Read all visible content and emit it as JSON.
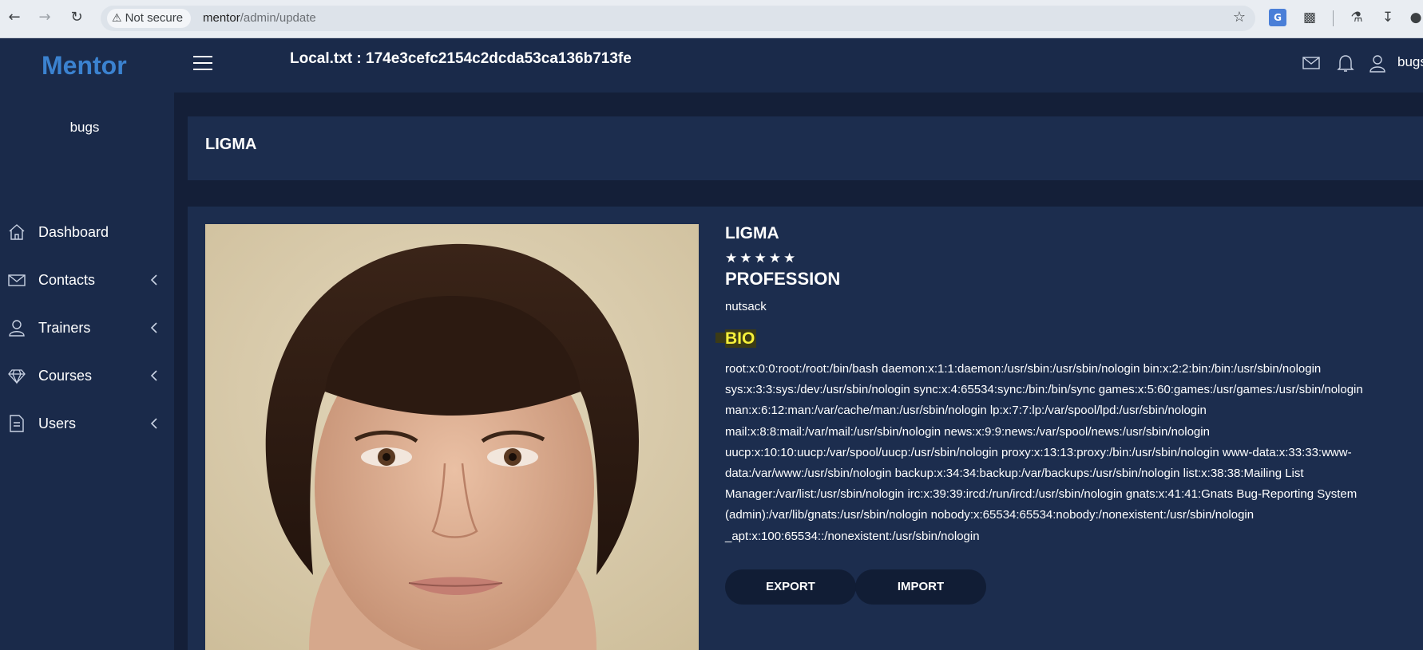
{
  "browser": {
    "security_label": "Not secure",
    "url_host": "mentor",
    "url_path": "/admin/update"
  },
  "sidebar": {
    "brand": "Mentor",
    "user": "bugs",
    "items": [
      {
        "label": "Dashboard",
        "icon": "home-icon"
      },
      {
        "label": "Contacts",
        "icon": "envelope-icon"
      },
      {
        "label": "Trainers",
        "icon": "user-icon"
      },
      {
        "label": "Courses",
        "icon": "diamond-icon"
      },
      {
        "label": "Users",
        "icon": "document-icon"
      }
    ]
  },
  "topbar": {
    "title": "Local.txt : 174e3cefc2154c2dcda53ca136b713fe",
    "user_name": "bugs"
  },
  "page": {
    "title": "LIGMA"
  },
  "profile": {
    "name": "LIGMA",
    "rating": 5,
    "stars": "★★★★★",
    "profession_heading": "PROFESSION",
    "profession": "nutsack",
    "bio_heading": "BIO",
    "bio": "root:x:0:0:root:/root:/bin/bash daemon:x:1:1:daemon:/usr/sbin:/usr/sbin/nologin bin:x:2:2:bin:/bin:/usr/sbin/nologin sys:x:3:3:sys:/dev:/usr/sbin/nologin sync:x:4:65534:sync:/bin:/bin/sync games:x:5:60:games:/usr/games:/usr/sbin/nologin man:x:6:12:man:/var/cache/man:/usr/sbin/nologin lp:x:7:7:lp:/var/spool/lpd:/usr/sbin/nologin mail:x:8:8:mail:/var/mail:/usr/sbin/nologin news:x:9:9:news:/var/spool/news:/usr/sbin/nologin uucp:x:10:10:uucp:/var/spool/uucp:/usr/sbin/nologin proxy:x:13:13:proxy:/bin:/usr/sbin/nologin www-data:x:33:33:www-data:/var/www:/usr/sbin/nologin backup:x:34:34:backup:/var/backups:/usr/sbin/nologin list:x:38:38:Mailing List Manager:/var/list:/usr/sbin/nologin irc:x:39:39:ircd:/run/ircd:/usr/sbin/nologin gnats:x:41:41:Gnats Bug-Reporting System (admin):/var/lib/gnats:/usr/sbin/nologin nobody:x:65534:65534:nobody:/nonexistent:/usr/sbin/nologin _apt:x:100:65534::/nonexistent:/usr/sbin/nologin",
    "export_label": "EXPORT",
    "import_label": "IMPORT"
  },
  "colors": {
    "background": "#1a2a4a",
    "brand": "#3b82d0",
    "bio_heading": "#f6f13a",
    "button": "#111d35"
  }
}
